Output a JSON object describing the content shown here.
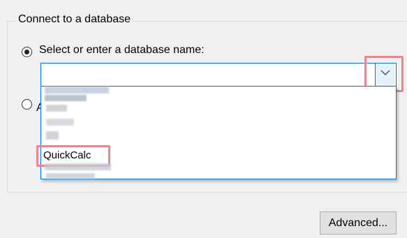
{
  "top_fragment": "ing ingo ~ ~ ~ ~ ~",
  "group": {
    "title": "Connect to a database",
    "option_select": {
      "label": "Select or enter a database name:",
      "checked": true
    },
    "option_other": {
      "label": "A",
      "checked": false
    }
  },
  "combo": {
    "value": "",
    "placeholder": ""
  },
  "dropdown": {
    "items": [
      "QuickCalc"
    ]
  },
  "buttons": {
    "advanced": "Advanced..."
  },
  "colors": {
    "accent_blue": "#0078d7",
    "annotation_red": "#e8888c"
  }
}
